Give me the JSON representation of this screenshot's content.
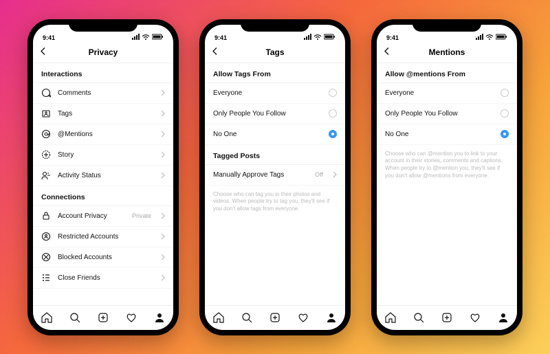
{
  "status": {
    "time": "9:41"
  },
  "phone1": {
    "title": "Privacy",
    "sections": {
      "interactions": {
        "header": "Interactions",
        "items": [
          {
            "label": "Comments"
          },
          {
            "label": "Tags"
          },
          {
            "label": "@Mentions"
          },
          {
            "label": "Story"
          },
          {
            "label": "Activity Status"
          }
        ]
      },
      "connections": {
        "header": "Connections",
        "items": [
          {
            "label": "Account Privacy",
            "value": "Private"
          },
          {
            "label": "Restricted Accounts"
          },
          {
            "label": "Blocked Accounts"
          },
          {
            "label": "Close Friends"
          }
        ]
      }
    }
  },
  "phone2": {
    "title": "Tags",
    "allow_header": "Allow Tags From",
    "options": [
      {
        "label": "Everyone",
        "selected": false
      },
      {
        "label": "Only People You Follow",
        "selected": false
      },
      {
        "label": "No One",
        "selected": true
      }
    ],
    "tagged_header": "Tagged Posts",
    "manual": {
      "label": "Manually Approve Tags",
      "value": "Off"
    },
    "help": "Choose who can tag you in their photos and videos. When people try to tag you, they'll see if you don't allow tags from everyone."
  },
  "phone3": {
    "title": "Mentions",
    "allow_header": "Allow @mentions From",
    "options": [
      {
        "label": "Everyone",
        "selected": false
      },
      {
        "label": "Only People You Follow",
        "selected": false
      },
      {
        "label": "No One",
        "selected": true
      }
    ],
    "help": "Choose who can @mention you to link to your account in their stories, comments and captions. When people try to @mention you, they'll see if you don't allow @mentions from everyone."
  }
}
